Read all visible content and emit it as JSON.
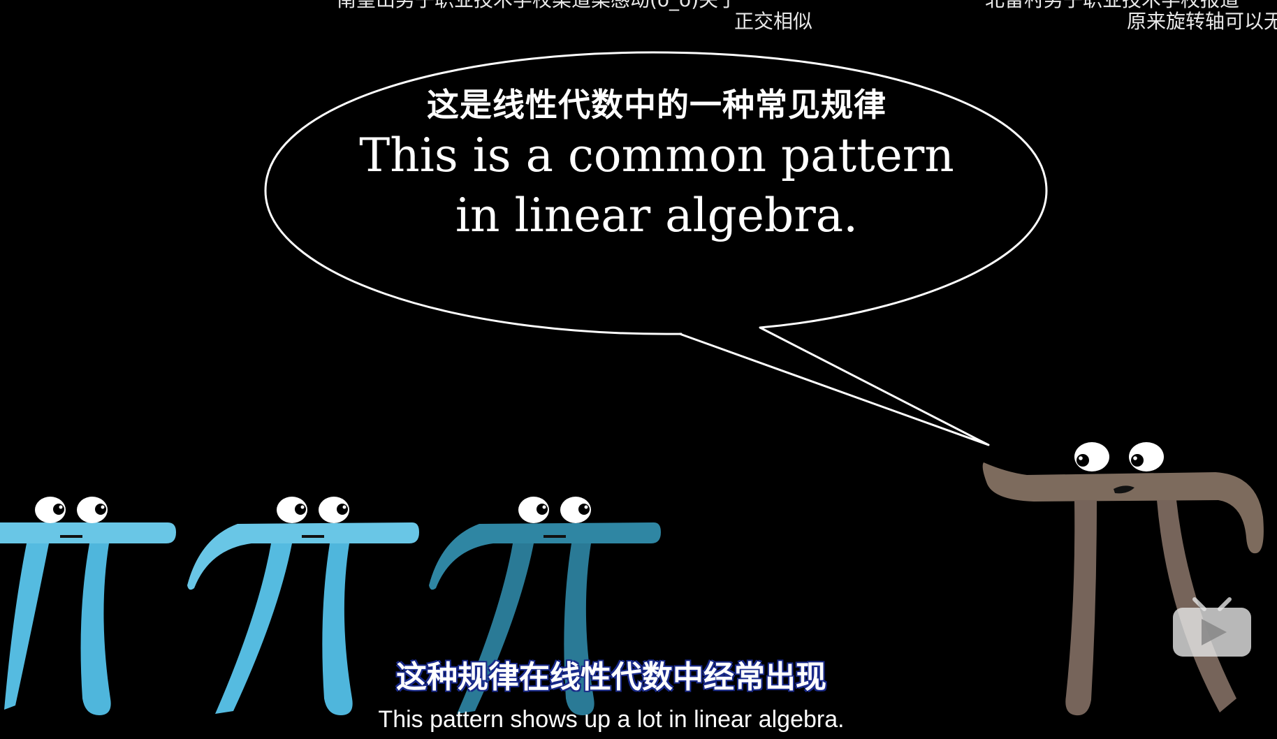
{
  "danmaku": [
    "南望山男子职业技术学校渠道渠感动(ó_ò)关于",
    "正交相似",
    "北雷村男子职业技术学校报道",
    "原来旋转轴可以无"
  ],
  "bubble": {
    "cn": "这是线性代数中的一种常见规律",
    "en_line1": "This is a common pattern",
    "en_line2": "in linear algebra."
  },
  "subtitle": {
    "cn": "这种规律在线性代数中经常出现",
    "en": "This pattern shows up a lot in linear algebra."
  },
  "colors": {
    "background": "#000000",
    "pi_light_blue": "#69c6e6",
    "pi_mid_blue": "#4bb3da",
    "pi_dark_blue": "#2f86a3",
    "pi_brown": "#7d6b5d"
  },
  "icons": {
    "logo": "bilibili-tv-icon"
  }
}
